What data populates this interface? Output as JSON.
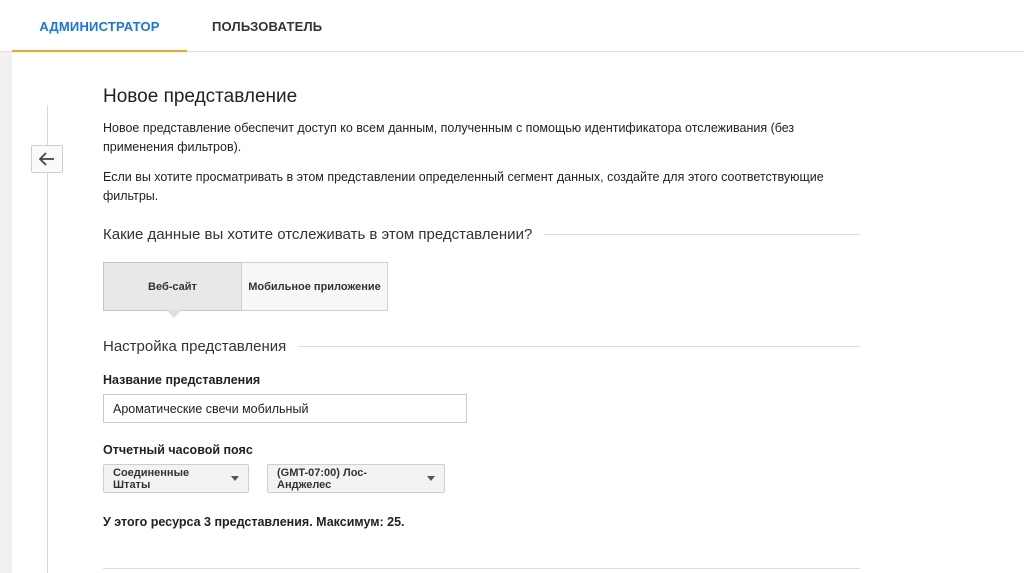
{
  "tabs": {
    "admin": "АДМИНИСТРАТОР",
    "user": "ПОЛЬЗОВАТЕЛЬ"
  },
  "page": {
    "title": "Новое представление",
    "description1": "Новое представление обеспечит доступ ко всем данным, полученным с помощью идентификатора отслеживания (без применения фильтров).",
    "description2": "Если вы хотите просматривать в этом представлении определенный сегмент данных, создайте для этого соответствующие фильтры."
  },
  "tracking": {
    "question": "Какие данные вы хотите отслеживать в этом представлении?",
    "options": [
      "Веб-сайт",
      "Мобильное приложение"
    ],
    "selected": "Веб-сайт"
  },
  "settings": {
    "heading": "Настройка представления",
    "view_name_label": "Название представления",
    "view_name_value": "Ароматические свечи мобильный",
    "timezone_label": "Отчетный часовой пояс",
    "country": "Соединенные Штаты",
    "timezone": "(GMT-07:00) Лос-Анджелес",
    "views_info": "У этого ресурса 3 представления. Максимум: 25."
  },
  "icons": {
    "back": "arrow-left-icon",
    "dropdown": "caret-down-icon"
  },
  "colors": {
    "accent": "#1a73e8",
    "tab_indicator": "#f4a623"
  }
}
